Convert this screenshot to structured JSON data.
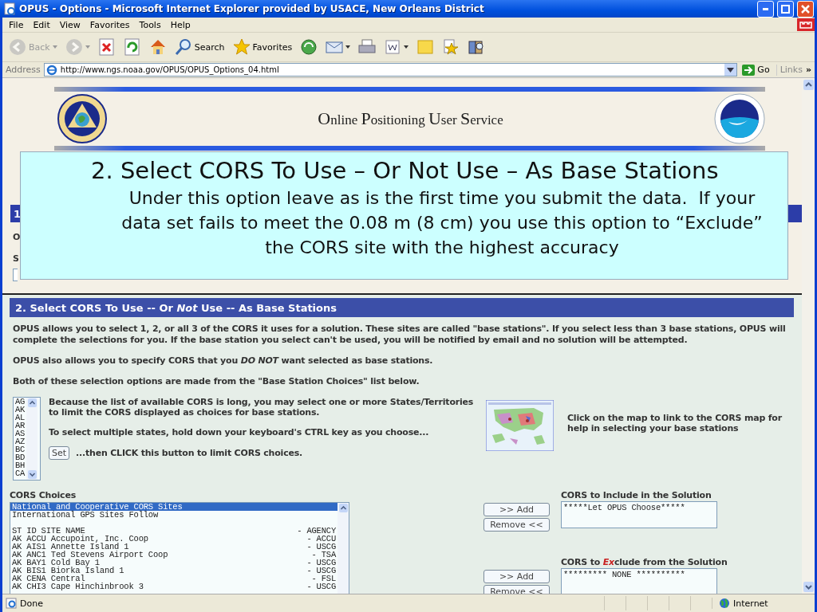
{
  "window": {
    "title": "OPUS - Options - Microsoft Internet Explorer provided by USACE, New Orleans District"
  },
  "menu": [
    "File",
    "Edit",
    "View",
    "Favorites",
    "Tools",
    "Help"
  ],
  "toolbar": [
    {
      "kind": "back",
      "label": "Back",
      "disabled": true,
      "dropdown": true
    },
    {
      "kind": "forward",
      "disabled": true,
      "dropdown": true
    },
    {
      "kind": "stop",
      "disabled": false,
      "dropdown": false
    },
    {
      "kind": "refresh",
      "disabled": false,
      "dropdown": false
    },
    {
      "kind": "home",
      "disabled": false,
      "dropdown": false
    },
    {
      "kind": "search",
      "label": "Search",
      "disabled": false,
      "dropdown": false
    },
    {
      "kind": "favorites",
      "label": "Favorites",
      "disabled": false,
      "dropdown": false
    },
    {
      "kind": "media",
      "disabled": false,
      "dropdown": false
    },
    {
      "kind": "mail",
      "disabled": false,
      "dropdown": true
    },
    {
      "kind": "print",
      "disabled": false,
      "dropdown": false
    },
    {
      "kind": "edit",
      "disabled": false,
      "dropdown": true
    },
    {
      "kind": "note",
      "disabled": false,
      "dropdown": false
    },
    {
      "kind": "messenger",
      "disabled": false,
      "dropdown": false
    },
    {
      "kind": "research",
      "disabled": false,
      "dropdown": false
    }
  ],
  "address": {
    "label": "Address",
    "value": "http://www.ngs.noaa.gov/OPUS/OPUS_Options_04.html",
    "go": "Go",
    "links": "Links",
    "more": "»"
  },
  "header": {
    "title": "Online Positioning User Service"
  },
  "section_1": {
    "heading": "1",
    "lines": [
      "O",
      "S"
    ]
  },
  "callout": {
    "title": "2. Select CORS To Use – Or Not Use – As Base Stations",
    "text": "Under this option leave as is the first time you submit the data.  If your data set fails to meet the 0.08 m (8 cm) you use this option to “Exclude” the CORS site with the highest accuracy"
  },
  "section_2": {
    "heading": "2. Select CORS To Use -- Or *Not* Use -- As Base Stations",
    "paragraphs": [
      "OPUS allows you to select 1, 2, or all 3 of the CORS it uses for a solution.   These sites are called \"base stations\".  If you select less than 3 base stations, OPUS will complete the selections for you.  If the base station you select can't be used, you will be notified by email and no solution will be attempted.",
      "OPUS also allows you to specify CORS that you *DO NOT* want selected as base stations.",
      "Both of these selection options are made from the \"Base Station Choices\" list below."
    ]
  },
  "states": [
    {
      "label": "AG",
      "selected": false
    },
    {
      "label": "AK",
      "selected": false
    },
    {
      "label": "AL",
      "selected": false
    },
    {
      "label": "AR",
      "selected": false
    },
    {
      "label": "AS",
      "selected": false
    },
    {
      "label": "AZ",
      "selected": false
    },
    {
      "label": "BC",
      "selected": false
    },
    {
      "label": "BD",
      "selected": false
    },
    {
      "label": "BH",
      "selected": false
    },
    {
      "label": "CA",
      "selected": false
    }
  ],
  "state_help": [
    "Because the list of available CORS is long, you may select one or more States/Territories to limit the CORS displayed as choices for base stations.",
    "To select multiple states, hold down your keyboard's CTRL key as you choose..."
  ],
  "set_button": "Set",
  "set_help": "...then CLICK this button to limit CORS choices.",
  "map": {
    "kind": "picture",
    "caption": "Click on the map to link to the CORS map for help in selecting your base stations"
  },
  "cors_choices": {
    "label": "CORS Choices",
    "rows": [
      {
        "kind": "option",
        "site": "National and Cooperative CORS Sites",
        "selected": true
      },
      {
        "kind": "option",
        "site": "International GPS Sites Follow",
        "selected": false
      },
      {
        "kind": "blank",
        "selected": false
      },
      {
        "kind": "option",
        "site": "ST ID SITE NAME",
        "agency": "- AGENCY",
        "selected": false
      },
      {
        "kind": "option",
        "site": "AK ACCU Accupoint, Inc. Coop",
        "agency": "- ACCU",
        "selected": false
      },
      {
        "kind": "option",
        "site": "AK AIS1 Annette Island 1",
        "agency": "- USCG",
        "selected": false
      },
      {
        "kind": "option",
        "site": "AK ANC1 Ted Stevens Airport Coop",
        "agency": "- TSA",
        "selected": false
      },
      {
        "kind": "option",
        "site": "AK BAY1 Cold Bay 1",
        "agency": "- USCG",
        "selected": false
      },
      {
        "kind": "option",
        "site": "AK BIS1 Biorka Island 1",
        "agency": "- USCG",
        "selected": false
      },
      {
        "kind": "option",
        "site": "AK CENA Central",
        "agency": "- FSL",
        "selected": false
      },
      {
        "kind": "option",
        "site": "AK CHI3 Cape Hinchinbrook 3",
        "agency": "- USCG",
        "selected": false
      }
    ]
  },
  "include": {
    "label": "CORS to Include in the Solution",
    "items": [
      "*****Let OPUS Choose*****"
    ],
    "buttons": [
      ">> Add",
      "Remove <<"
    ]
  },
  "exclude": {
    "label_parts": [
      "CORS to ",
      "Ex",
      "clude from the Solution"
    ],
    "items": [
      "********* NONE **********"
    ],
    "buttons": [
      ">> Add",
      "Remove <<"
    ]
  },
  "status": {
    "text": "Done",
    "zone": "Internet"
  }
}
